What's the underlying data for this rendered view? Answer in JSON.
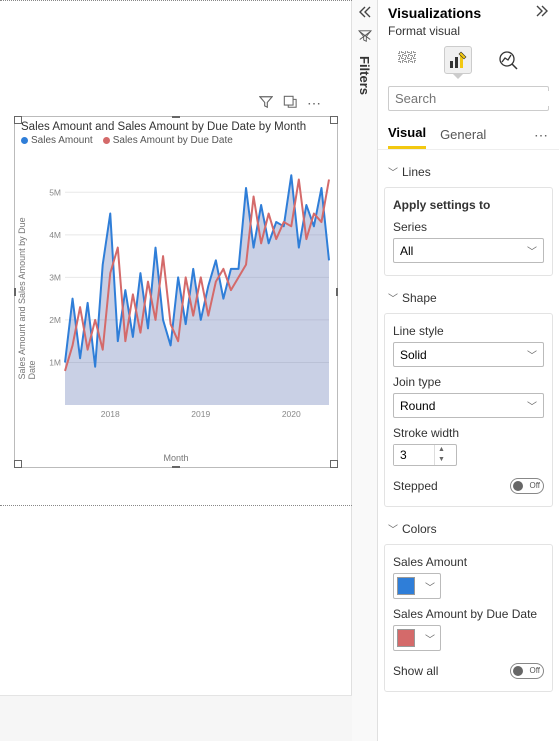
{
  "colors": {
    "series1": "#2f7ed8",
    "series2": "#d46a6a",
    "accent": "#f2c811"
  },
  "filters": {
    "label": "Filters"
  },
  "viz_panel": {
    "title": "Visualizations",
    "subtitle": "Format visual",
    "search_placeholder": "Search",
    "tabs": {
      "visual": "Visual",
      "general": "General"
    },
    "sections": {
      "lines": {
        "label": "Lines",
        "apply_label": "Apply settings to",
        "series_label": "Series",
        "series_value": "All"
      },
      "shape": {
        "label": "Shape",
        "line_style_label": "Line style",
        "line_style_value": "Solid",
        "join_label": "Join type",
        "join_value": "Round",
        "stroke_label": "Stroke width",
        "stroke_value": "3",
        "stepped_label": "Stepped",
        "stepped_state": "Off"
      },
      "colors": {
        "label": "Colors",
        "s1_label": "Sales Amount",
        "s2_label": "Sales Amount by Due Date",
        "showall_label": "Show all",
        "showall_state": "Off"
      }
    }
  },
  "chart": {
    "toolbar": {
      "more": "⋯"
    },
    "title": "Sales Amount and Sales Amount by Due Date by Month",
    "legend": {
      "s1": "Sales Amount",
      "s2": "Sales Amount by Due Date"
    },
    "ylabel": "Sales Amount and Sales Amount by Due Date",
    "xlabel": "Month",
    "yticks": [
      "1M",
      "2M",
      "3M",
      "4M",
      "5M"
    ],
    "xticks": [
      "2018",
      "2019",
      "2020"
    ]
  },
  "chart_data": {
    "type": "line",
    "title": "Sales Amount and Sales Amount by Due Date by Month",
    "xlabel": "Month",
    "ylabel": "Sales Amount and Sales Amount by Due Date",
    "ylim": [
      0,
      5500000
    ],
    "x": [
      "2017-07",
      "2017-08",
      "2017-09",
      "2017-10",
      "2017-11",
      "2017-12",
      "2018-01",
      "2018-02",
      "2018-03",
      "2018-04",
      "2018-05",
      "2018-06",
      "2018-07",
      "2018-08",
      "2018-09",
      "2018-10",
      "2018-11",
      "2018-12",
      "2019-01",
      "2019-02",
      "2019-03",
      "2019-04",
      "2019-05",
      "2019-06",
      "2019-07",
      "2019-08",
      "2019-09",
      "2019-10",
      "2019-11",
      "2019-12",
      "2020-01",
      "2020-02",
      "2020-03",
      "2020-04",
      "2020-05",
      "2020-06"
    ],
    "series": [
      {
        "name": "Sales Amount",
        "color": "#2f7ed8",
        "values": [
          1000000,
          2500000,
          1100000,
          2400000,
          900000,
          3300000,
          4500000,
          1500000,
          2700000,
          1600000,
          3100000,
          1800000,
          3700000,
          2000000,
          1400000,
          3000000,
          1900000,
          3200000,
          2000000,
          2800000,
          3400000,
          2500000,
          3200000,
          3200000,
          5100000,
          3700000,
          4700000,
          3800000,
          4300000,
          4200000,
          5400000,
          3700000,
          4700000,
          4200000,
          5100000,
          3400000
        ]
      },
      {
        "name": "Sales Amount by Due Date",
        "color": "#d46a6a",
        "values": [
          800000,
          1400000,
          2300000,
          1300000,
          2000000,
          1300000,
          3100000,
          3700000,
          1500000,
          2600000,
          1700000,
          2900000,
          2000000,
          3500000,
          1900000,
          1500000,
          3000000,
          2100000,
          3000000,
          2100000,
          2900000,
          3200000,
          2700000,
          3000000,
          3300000,
          4900000,
          3800000,
          4500000,
          3900000,
          4300000,
          4200000,
          5300000,
          3900000,
          4500000,
          4300000,
          5300000
        ]
      }
    ]
  }
}
